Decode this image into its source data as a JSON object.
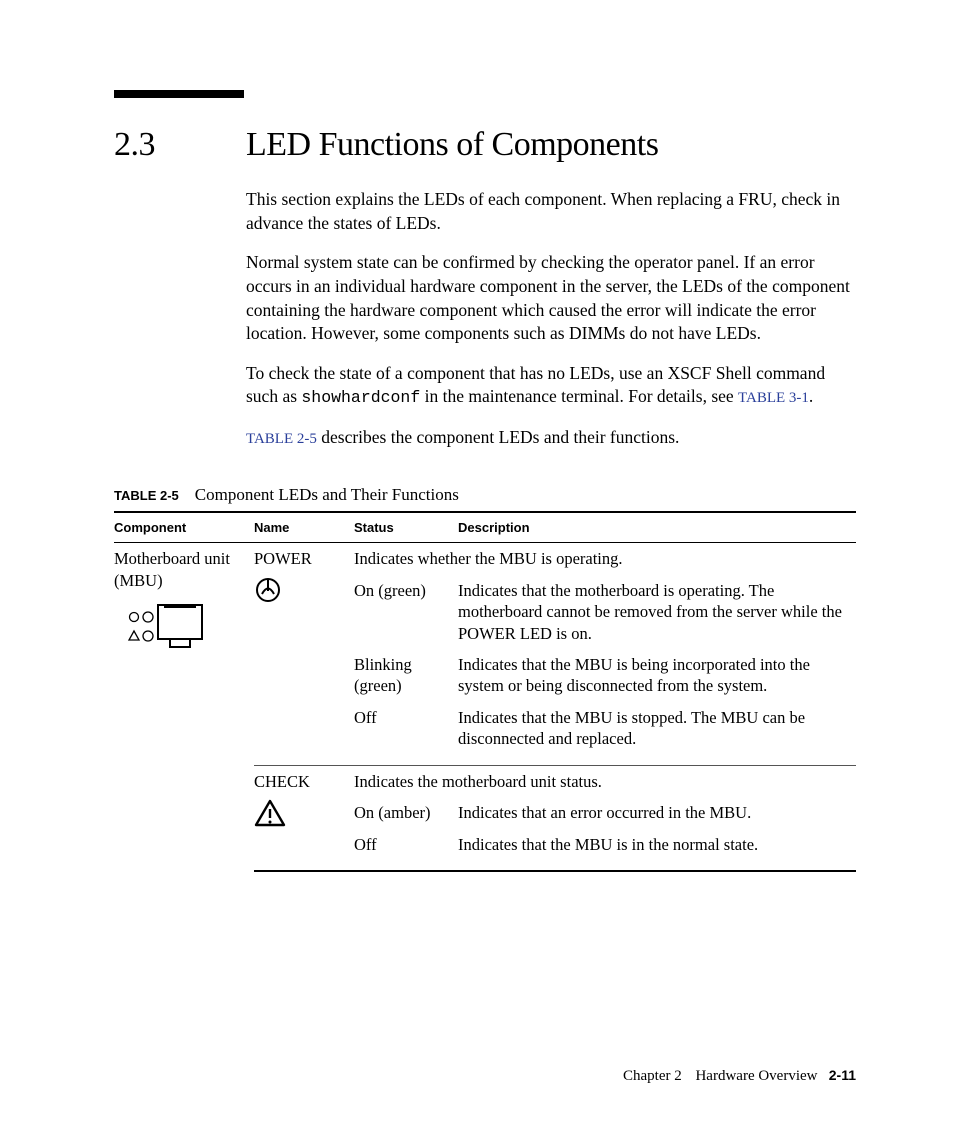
{
  "heading": {
    "number": "2.3",
    "title": "LED Functions of Components"
  },
  "paragraphs": {
    "p1": "This section explains the LEDs of each component. When replacing a FRU, check in advance the states of LEDs.",
    "p2": "Normal system state can be confirmed by checking the operator panel. If an error occurs in an individual hardware component in the server, the LEDs of the component containing the hardware component which caused the error will indicate the error location. However, some components such as DIMMs do not have LEDs.",
    "p3a": "To check the state of a component that has no LEDs, use an XSCF Shell command such as ",
    "p3_cmd": "showhardconf",
    "p3b": " in the maintenance terminal. For details, see ",
    "p3_xref": "TABLE 3-1",
    "p3c": ".",
    "p4_xref": "TABLE 2-5",
    "p4b": " describes the component LEDs and their functions."
  },
  "table": {
    "label": "TABLE 2-5",
    "title": "Component LEDs and Their Functions",
    "headers": {
      "c1": "Component",
      "c2": "Name",
      "c3": "Status",
      "c4": "Description"
    },
    "component": "Motherboard unit (MBU)",
    "groups": [
      {
        "name": "POWER",
        "summary": "Indicates whether the MBU is operating.",
        "rows": [
          {
            "status": "On (green)",
            "desc": "Indicates that the motherboard is operating. The motherboard cannot be removed from the server while the POWER LED is on."
          },
          {
            "status": "Blinking (green)",
            "desc": "Indicates that the MBU is being incorporated into the system or being disconnected from the system."
          },
          {
            "status": "Off",
            "desc": "Indicates that the MBU is stopped. The MBU can be disconnected and replaced."
          }
        ]
      },
      {
        "name": "CHECK",
        "summary": "Indicates the motherboard unit status.",
        "rows": [
          {
            "status": "On (amber)",
            "desc": "Indicates that an error occurred in the MBU."
          },
          {
            "status": "Off",
            "desc": "Indicates that the MBU is in the normal state."
          }
        ]
      }
    ]
  },
  "footer": {
    "chapter": "Chapter 2",
    "section": "Hardware Overview",
    "page": "2-11"
  }
}
